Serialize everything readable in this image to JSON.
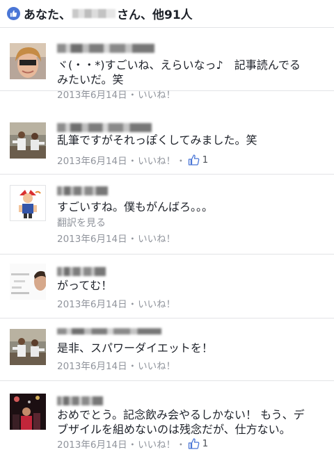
{
  "header": {
    "prefix": "あなた、",
    "suffix": "さん、他91人"
  },
  "comments": [
    {
      "text": "ヾ(・・*)すごいね、えらいなっ♪　記事読んでる\nみたいだ。笑",
      "date": "2013年6月14日",
      "like_label": "いいね！",
      "like_count": ""
    },
    {
      "text": "乱筆ですがそれっぽくしてみました。笑",
      "date": "2013年6月14日",
      "like_label": "いいね！",
      "like_count": "1"
    },
    {
      "text": "すごいすね。僕もがんばろ。。。",
      "translate": "翻訳を見る",
      "date": "2013年6月14日",
      "like_label": "いいね！",
      "like_count": ""
    },
    {
      "text": "がってむ！",
      "date": "2013年6月14日",
      "like_label": "いいね！",
      "like_count": ""
    },
    {
      "text": "是非、スパワーダイエットを！",
      "date": "2013年6月14日",
      "like_label": "いいね！",
      "like_count": ""
    },
    {
      "text": "おめでとう。記念飲み会やるしかない！ もう、デ\nブザイルを組めないのは残念だが、仕方ない。",
      "date": "2013年6月14日",
      "like_label": "いいね！",
      "like_count": "1"
    }
  ],
  "separator": "・",
  "colors": {
    "accent": "#4a76d6",
    "meta_gray": "#90949c",
    "text": "#1d2129",
    "divider": "#e2e3e6"
  }
}
